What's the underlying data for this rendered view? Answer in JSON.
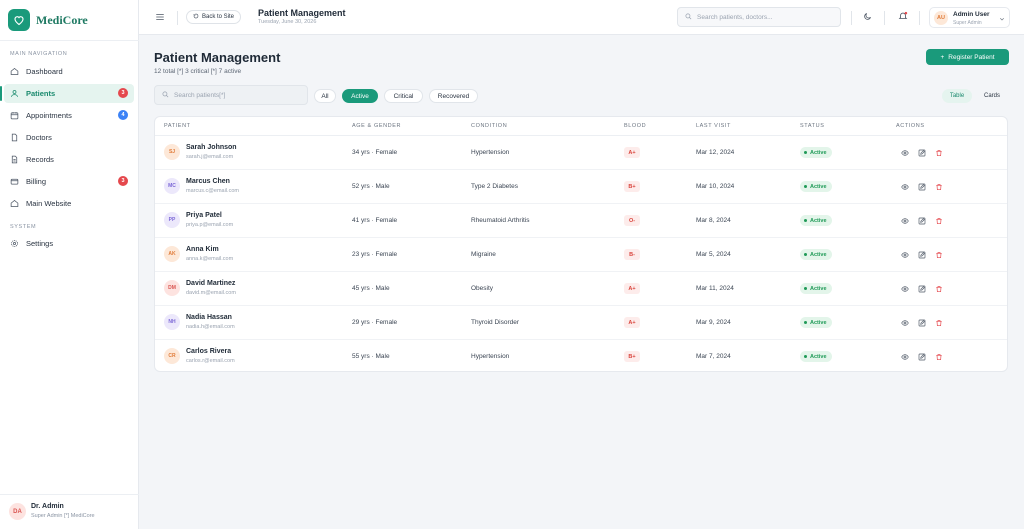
{
  "brand": {
    "name": "MediCore",
    "accent": "#1a9a7b"
  },
  "sidebar": {
    "section_main": "MAIN NAVIGATION",
    "section_system": "SYSTEM",
    "items": [
      {
        "label": "Dashboard",
        "icon": "home-icon"
      },
      {
        "label": "Patients",
        "icon": "users-icon",
        "badge": "3",
        "active": true
      },
      {
        "label": "Appointments",
        "icon": "calendar-icon",
        "badge": "4"
      },
      {
        "label": "Doctors",
        "icon": "document-icon"
      },
      {
        "label": "Records",
        "icon": "document-icon"
      },
      {
        "label": "Billing",
        "icon": "card-icon",
        "badge": "3"
      },
      {
        "label": "Main Website",
        "icon": "home-icon"
      }
    ],
    "settings_label": "Settings",
    "footer": {
      "initials": "DA",
      "name": "Dr. Admin",
      "role": "Super Admin [*] MediCore"
    }
  },
  "topbar": {
    "back_label": "Back to Site",
    "title": "Patient Management",
    "date": "Tuesday, June 30, 2026",
    "search_placeholder": "Search patients, doctors...",
    "user": {
      "initials": "AU",
      "name": "Admin User",
      "role": "Super Admin"
    }
  },
  "main": {
    "title": "Patient Management",
    "subtitle": "12 total [*] 3 critical [*] 7 active",
    "register_label": "Register Patient",
    "search_placeholder": "Search patients[*]",
    "filters": [
      "All",
      "Active",
      "Critical",
      "Recovered"
    ],
    "active_filter": "Active",
    "view_table": "Table",
    "view_cards": "Cards"
  },
  "table": {
    "headers": [
      "PATIENT",
      "AGE & GENDER",
      "CONDITION",
      "BLOOD",
      "LAST VISIT",
      "STATUS",
      "ACTIONS"
    ],
    "rows": [
      {
        "initials": "SJ",
        "name": "Sarah Johnson",
        "email": "sarah.j@email.com",
        "age_gender": "34 yrs · Female",
        "condition": "Hypertension",
        "blood": "A+",
        "last_visit": "Mar 12, 2024",
        "status": "Active"
      },
      {
        "initials": "MC",
        "name": "Marcus Chen",
        "email": "marcus.c@email.com",
        "age_gender": "52 yrs · Male",
        "condition": "Type 2 Diabetes",
        "blood": "B+",
        "last_visit": "Mar 10, 2024",
        "status": "Active"
      },
      {
        "initials": "PP",
        "name": "Priya Patel",
        "email": "priya.p@email.com",
        "age_gender": "41 yrs · Female",
        "condition": "Rheumatoid Arthritis",
        "blood": "O-",
        "last_visit": "Mar 8, 2024",
        "status": "Active"
      },
      {
        "initials": "AK",
        "name": "Anna Kim",
        "email": "anna.k@email.com",
        "age_gender": "23 yrs · Female",
        "condition": "Migraine",
        "blood": "B-",
        "last_visit": "Mar 5, 2024",
        "status": "Active"
      },
      {
        "initials": "DM",
        "name": "David Martinez",
        "email": "david.m@email.com",
        "age_gender": "45 yrs · Male",
        "condition": "Obesity",
        "blood": "A+",
        "last_visit": "Mar 11, 2024",
        "status": "Active"
      },
      {
        "initials": "NH",
        "name": "Nadia Hassan",
        "email": "nadia.h@email.com",
        "age_gender": "29 yrs · Female",
        "condition": "Thyroid Disorder",
        "blood": "A+",
        "last_visit": "Mar 9, 2024",
        "status": "Active"
      },
      {
        "initials": "CR",
        "name": "Carlos Rivera",
        "email": "carlos.r@email.com",
        "age_gender": "55 yrs · Male",
        "condition": "Hypertension",
        "blood": "B+",
        "last_visit": "Mar 7, 2024",
        "status": "Active"
      }
    ]
  }
}
